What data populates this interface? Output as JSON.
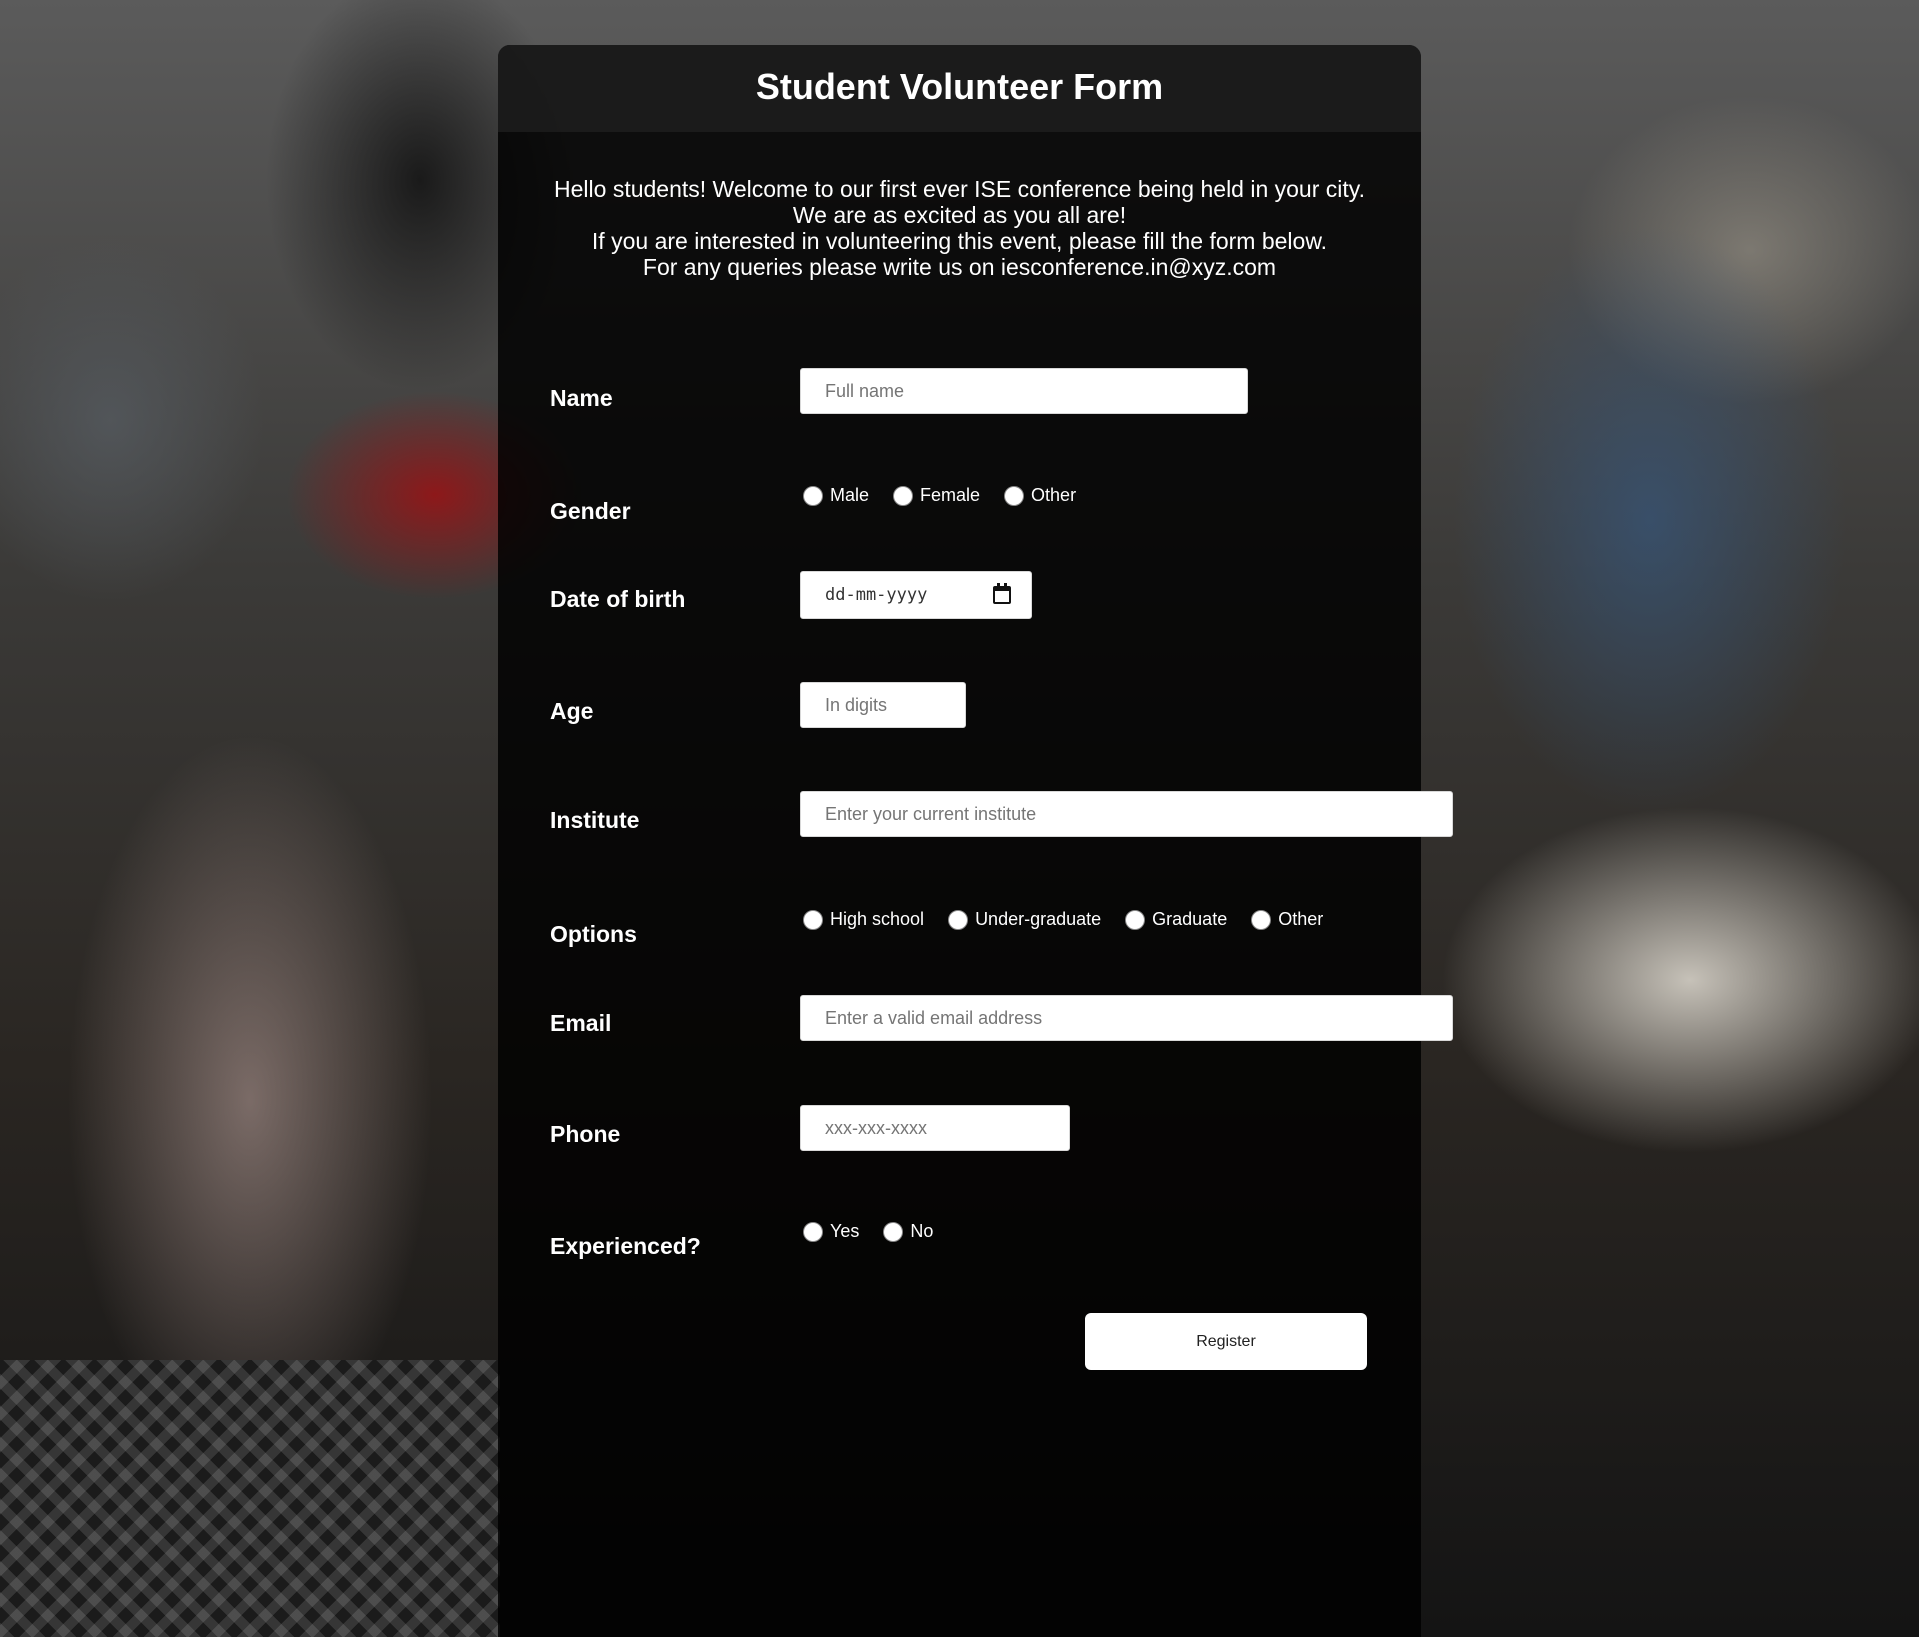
{
  "form": {
    "title": "Student Volunteer Form",
    "intro": [
      "Hello students! Welcome to our first ever ISE conference being held in your city.",
      "We are as excited as you all are!",
      "If you are interested in volunteering this event, please fill the form below.",
      "For any queries please write us on iesconference.in@xyz.com"
    ],
    "name": {
      "label": "Name",
      "placeholder": "Full name"
    },
    "gender": {
      "label": "Gender",
      "options": [
        "Male",
        "Female",
        "Other"
      ]
    },
    "dob": {
      "label": "Date of birth",
      "placeholder": "dd-mm-yyyy"
    },
    "age": {
      "label": "Age",
      "placeholder": "In digits"
    },
    "institute": {
      "label": "Institute",
      "placeholder": "Enter your current institute"
    },
    "options": {
      "label": "Options",
      "choices": [
        "High school",
        "Under-graduate",
        "Graduate",
        "Other"
      ]
    },
    "email": {
      "label": "Email",
      "placeholder": "Enter a valid email address"
    },
    "phone": {
      "label": "Phone",
      "placeholder": "xxx-xxx-xxxx"
    },
    "experienced": {
      "label": "Experienced?",
      "options": [
        "Yes",
        "No"
      ]
    },
    "register_label": "Register"
  }
}
